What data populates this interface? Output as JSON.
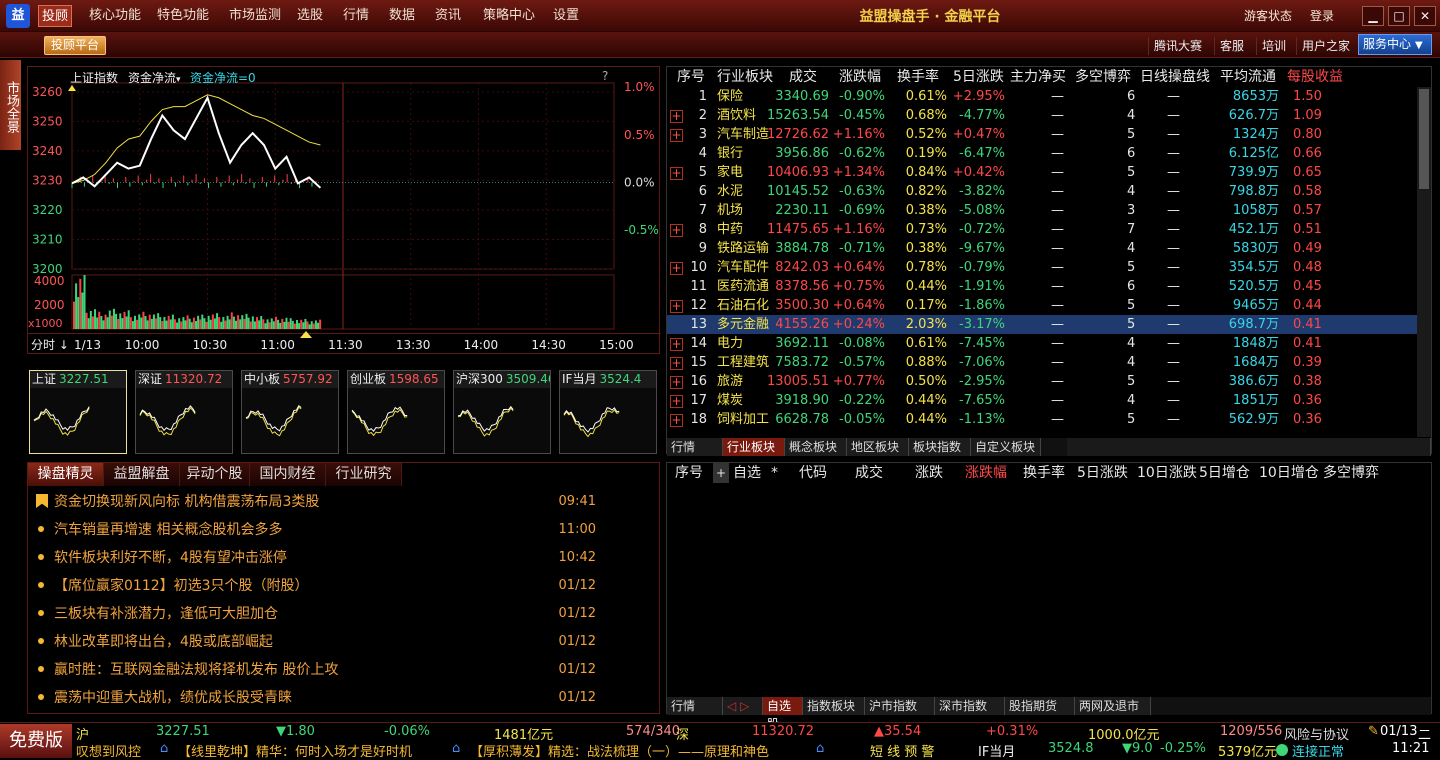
{
  "app": {
    "logo": "益",
    "title": "益盟操盘手 · 金融平台",
    "guest_status": "游客状态",
    "login": "登录",
    "menu": [
      "投顾",
      "核心功能",
      "特色功能",
      "市场监测",
      "选股",
      "行情",
      "数据",
      "资讯",
      "策略中心",
      "设置"
    ]
  },
  "toolbar": {
    "platform": "投顾平台",
    "links": [
      "腾讯大赛",
      "客服",
      "培训",
      "用户之家"
    ],
    "service": "服务中心"
  },
  "sidetab": "市场全景",
  "index_chart": {
    "name": "上证指数",
    "indicator": "资金净流",
    "indicator_value": "资金净流=0",
    "question": "?",
    "price_ticks": [
      "3260",
      "3250",
      "3240",
      "3230",
      "3220",
      "3210",
      "3200"
    ],
    "pct_ticks": [
      "1.0%",
      "0.5%",
      "0.0%",
      "-0.5%"
    ],
    "vol_ticks": [
      "4000",
      "2000"
    ],
    "vol_unit": "x1000",
    "time_ticks": [
      "1/13",
      "10:00",
      "10:30",
      "11:00",
      "11:30",
      "13:30",
      "14:00",
      "14:30",
      "15:00"
    ],
    "period": "分时",
    "colors": {
      "price": "#ffffff",
      "avg": "#f0e040",
      "base": "#38d7e6",
      "up": "#ff4040",
      "down": "#3fd67a"
    }
  },
  "thumbs": [
    {
      "name": "上证",
      "value": "3227.51",
      "dir": "down"
    },
    {
      "name": "深证",
      "value": "11320.72",
      "dir": "up"
    },
    {
      "name": "中小板",
      "value": "5757.92",
      "dir": "up"
    },
    {
      "name": "创业板",
      "value": "1598.65",
      "dir": "up"
    },
    {
      "name": "沪深300",
      "value": "3509.46",
      "dir": "down"
    },
    {
      "name": "IF当月",
      "value": "3524.4",
      "dir": "down"
    }
  ],
  "news": {
    "tabs": [
      "操盘精灵",
      "益盟解盘",
      "异动个股",
      "国内财经",
      "行业研究"
    ],
    "items": [
      {
        "title": "资金切换现新风向标 机构借震荡布局3类股",
        "time": "09:41"
      },
      {
        "title": "汽车销量再增速 相关概念股机会多多",
        "time": "11:00"
      },
      {
        "title": "软件板块利好不断，4股有望冲击涨停",
        "time": "10:42"
      },
      {
        "title": "【席位赢家0112】初选3只个股（附股）",
        "time": "01/12"
      },
      {
        "title": "三板块有补涨潜力，逢低可大胆加仓",
        "time": "01/12"
      },
      {
        "title": "林业改革即将出台，4股或底部崛起",
        "time": "01/12"
      },
      {
        "title": "赢时胜：互联网金融法规将择机发布 股价上攻",
        "time": "01/12"
      },
      {
        "title": "震荡中迎重大战机，绩优成长股受青睐",
        "time": "01/12"
      }
    ]
  },
  "sectors": {
    "headers": [
      "序号",
      "行业板块",
      "成交",
      "涨跌幅",
      "换手率",
      "5日涨跌",
      "主力净买",
      "多空博弈",
      "日线操盘线",
      "平均流通",
      "每股收益"
    ],
    "rows": [
      {
        "n": "1",
        "name": "保险",
        "amt": "3340.69",
        "chg": "-0.90%",
        "turn": "0.61%",
        "d5": "+2.95%",
        "net": "—",
        "lb": "6",
        "line": "—",
        "flow": "8653万",
        "eps": "1.50",
        "plus": false
      },
      {
        "n": "2",
        "name": "酒饮料",
        "amt": "15263.54",
        "chg": "-0.45%",
        "turn": "0.68%",
        "d5": "-4.77%",
        "net": "—",
        "lb": "4",
        "line": "—",
        "flow": "626.7万",
        "eps": "1.09",
        "plus": true
      },
      {
        "n": "3",
        "name": "汽车制造",
        "amt": "12726.62",
        "chg": "+1.16%",
        "turn": "0.52%",
        "d5": "+0.47%",
        "net": "—",
        "lb": "5",
        "line": "—",
        "flow": "1324万",
        "eps": "0.80",
        "plus": true
      },
      {
        "n": "4",
        "name": "银行",
        "amt": "3956.86",
        "chg": "-0.62%",
        "turn": "0.19%",
        "d5": "-6.47%",
        "net": "—",
        "lb": "6",
        "line": "—",
        "flow": "6.125亿",
        "eps": "0.66",
        "plus": false
      },
      {
        "n": "5",
        "name": "家电",
        "amt": "10406.93",
        "chg": "+1.34%",
        "turn": "0.84%",
        "d5": "+0.42%",
        "net": "—",
        "lb": "5",
        "line": "—",
        "flow": "739.9万",
        "eps": "0.65",
        "plus": true
      },
      {
        "n": "6",
        "name": "水泥",
        "amt": "10145.52",
        "chg": "-0.63%",
        "turn": "0.82%",
        "d5": "-3.82%",
        "net": "—",
        "lb": "4",
        "line": "—",
        "flow": "798.8万",
        "eps": "0.58",
        "plus": false
      },
      {
        "n": "7",
        "name": "机场",
        "amt": "2230.11",
        "chg": "-0.69%",
        "turn": "0.38%",
        "d5": "-5.08%",
        "net": "—",
        "lb": "3",
        "line": "—",
        "flow": "1058万",
        "eps": "0.57",
        "plus": false
      },
      {
        "n": "8",
        "name": "中药",
        "amt": "11475.65",
        "chg": "+1.16%",
        "turn": "0.73%",
        "d5": "-0.72%",
        "net": "—",
        "lb": "7",
        "line": "—",
        "flow": "452.1万",
        "eps": "0.51",
        "plus": true
      },
      {
        "n": "9",
        "name": "铁路运输",
        "amt": "3884.78",
        "chg": "-0.71%",
        "turn": "0.38%",
        "d5": "-9.67%",
        "net": "—",
        "lb": "4",
        "line": "—",
        "flow": "5830万",
        "eps": "0.49",
        "plus": false
      },
      {
        "n": "10",
        "name": "汽车配件",
        "amt": "8242.03",
        "chg": "+0.64%",
        "turn": "0.78%",
        "d5": "-0.79%",
        "net": "—",
        "lb": "5",
        "line": "—",
        "flow": "354.5万",
        "eps": "0.48",
        "plus": true
      },
      {
        "n": "11",
        "name": "医药流通",
        "amt": "8378.56",
        "chg": "+0.75%",
        "turn": "0.44%",
        "d5": "-1.91%",
        "net": "—",
        "lb": "6",
        "line": "—",
        "flow": "520.5万",
        "eps": "0.45",
        "plus": false
      },
      {
        "n": "12",
        "name": "石油石化",
        "amt": "3500.30",
        "chg": "+0.64%",
        "turn": "0.17%",
        "d5": "-1.86%",
        "net": "—",
        "lb": "5",
        "line": "—",
        "flow": "9465万",
        "eps": "0.44",
        "plus": true
      },
      {
        "n": "13",
        "name": "多元金融",
        "amt": "4155.26",
        "chg": "+0.24%",
        "turn": "2.03%",
        "d5": "-3.17%",
        "net": "—",
        "lb": "5",
        "line": "—",
        "flow": "698.7万",
        "eps": "0.41",
        "plus": false
      },
      {
        "n": "14",
        "name": "电力",
        "amt": "3692.11",
        "chg": "-0.08%",
        "turn": "0.61%",
        "d5": "-7.45%",
        "net": "—",
        "lb": "4",
        "line": "—",
        "flow": "1848万",
        "eps": "0.41",
        "plus": true
      },
      {
        "n": "15",
        "name": "工程建筑",
        "amt": "7583.72",
        "chg": "-0.57%",
        "turn": "0.88%",
        "d5": "-7.06%",
        "net": "—",
        "lb": "4",
        "line": "—",
        "flow": "1684万",
        "eps": "0.39",
        "plus": true
      },
      {
        "n": "16",
        "name": "旅游",
        "amt": "13005.51",
        "chg": "+0.77%",
        "turn": "0.50%",
        "d5": "-2.95%",
        "net": "—",
        "lb": "5",
        "line": "—",
        "flow": "386.6万",
        "eps": "0.38",
        "plus": true
      },
      {
        "n": "17",
        "name": "煤炭",
        "amt": "3918.90",
        "chg": "-0.22%",
        "turn": "0.44%",
        "d5": "-7.65%",
        "net": "—",
        "lb": "4",
        "line": "—",
        "flow": "1851万",
        "eps": "0.36",
        "plus": true
      },
      {
        "n": "18",
        "name": "饲料加工",
        "amt": "6628.78",
        "chg": "-0.05%",
        "turn": "0.44%",
        "d5": "-1.13%",
        "net": "—",
        "lb": "5",
        "line": "—",
        "flow": "562.9万",
        "eps": "0.36",
        "plus": true
      }
    ],
    "selected_index": 12,
    "tabs": [
      "行情",
      "行业板块",
      "概念板块",
      "地区板块",
      "板块指数",
      "自定义板块"
    ]
  },
  "watch": {
    "headers": [
      "序号",
      "+",
      "自选",
      "*",
      "代码",
      "成交",
      "涨跌",
      "涨跌幅",
      "换手率",
      "5日涨跌",
      "10日涨跌",
      "5日增仓",
      "10日增仓",
      "多空博弈"
    ],
    "tabs": [
      "行情",
      "自选股",
      "指数板块",
      "沪市指数",
      "深市指数",
      "股指期货",
      "两网及退市"
    ]
  },
  "status": {
    "free": "免费版",
    "sh_label": "沪",
    "sh_val": "3227.51",
    "sh_chg": "▼1.80",
    "sh_pct": "-0.06%",
    "sh_amt": "1481亿元",
    "sh_ud": "574/340",
    "sz_label": "深",
    "sz_val": "11320.72",
    "sz_chg": "▲35.54",
    "sz_pct": "+0.31%",
    "sz_amt": "1000.0亿元",
    "sz_ud": "1209/556",
    "risk": "风险与协议",
    "date": "01/13",
    "weekday": "二",
    "time": "11:21",
    "ticker1": "叹想到风控",
    "ticker2": "【线里乾坤】精华：何时入场才是好时机",
    "ticker3": "【厚积薄发】精选：战法梳理（一）——原理和神色",
    "warn": "短 线 预 警",
    "if_label": "IF当月",
    "if_val": "3524.8",
    "if_chg": "▼9.0",
    "if_pct": "-0.25%",
    "if_amt": "5379亿元",
    "conn": "连接正常"
  },
  "chart_data": {
    "type": "line",
    "title": "上证指数",
    "ylim": [
      3200,
      3263
    ],
    "base": 3229.31,
    "x": [
      "9:30",
      "9:35",
      "9:40",
      "9:45",
      "9:50",
      "9:55",
      "10:00",
      "10:05",
      "10:10",
      "10:15",
      "10:20",
      "10:25",
      "10:30",
      "10:35",
      "10:40",
      "10:45",
      "10:50",
      "10:55",
      "11:00",
      "11:05",
      "11:10",
      "11:15",
      "11:21"
    ],
    "series": [
      {
        "values": [
          3229,
          3231,
          3228,
          3232,
          3236,
          3234,
          3235,
          3244,
          3252,
          3247,
          3244,
          3251,
          3258,
          3246,
          3236,
          3242,
          3246,
          3242,
          3234,
          3238,
          3229,
          3231,
          3227.5
        ]
      },
      {
        "values": [
          3229,
          3230,
          3232,
          3236,
          3241,
          3244,
          3245,
          3250,
          3254,
          3255,
          3255,
          3257,
          3259,
          3258,
          3256,
          3254,
          3252,
          3251,
          3249,
          3247,
          3245,
          3243,
          3242
        ]
      }
    ],
    "volume": [
      3800,
      1500,
      1200,
      1400,
      1300,
      1100,
      1200,
      1100,
      1000,
      900,
      950,
      1000,
      1100,
      1000,
      1150,
      1050,
      900,
      800,
      850,
      750,
      700,
      650,
      650
    ]
  }
}
